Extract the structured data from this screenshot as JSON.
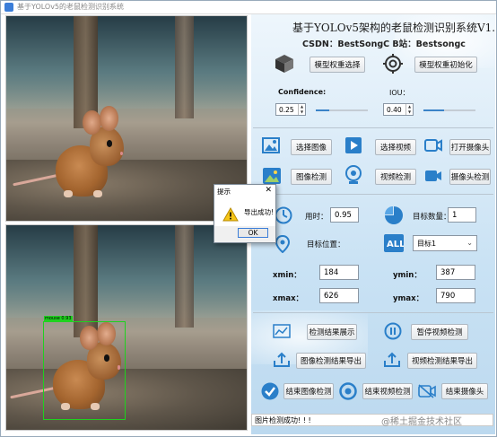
{
  "window": {
    "title": "基于YOLOv5的老鼠检测识别系统"
  },
  "header": {
    "title": "基于YOLOv5架构的老鼠检测识别系统V1.0",
    "subtitle": "CSDN：BestSongC  B站：Bestsongc"
  },
  "model": {
    "select_label": "模型权重选择",
    "init_label": "模型权重初始化"
  },
  "params": {
    "confidence_label": "Confidence:",
    "iou_label": "IOU：",
    "confidence_value": "0.25",
    "iou_value": "0.40",
    "confidence_fraction": 0.25,
    "iou_fraction": 0.4
  },
  "buttons": {
    "select_image": "选择图像",
    "select_video": "选择视频",
    "open_camera": "打开摄像头",
    "image_detect": "图像检测",
    "video_detect": "视频检测",
    "camera_detect": "摄像头检测",
    "show_results": "检测结果展示",
    "pause_video": "暂停视频检测",
    "export_image": "图像检测结果导出",
    "export_video": "视频检测结果导出",
    "end_image": "结束图像检测",
    "end_video": "结束视频检测",
    "end_camera": "结束摄像头"
  },
  "stats": {
    "time_label": "用时：",
    "time_value": "0.95",
    "count_label": "目标数量：",
    "count_value": "1",
    "position_label": "目标位置：",
    "target_select": "目标1"
  },
  "coords": {
    "xmin_label": "xmin：",
    "xmin": "184",
    "ymin_label": "ymin：",
    "ymin": "387",
    "xmax_label": "xmax：",
    "xmax": "626",
    "ymax_label": "ymax：",
    "ymax": "790"
  },
  "detection": {
    "box_label": "mouse 0.93"
  },
  "dialog": {
    "title": "提示",
    "close": "✕",
    "message": "导出成功!",
    "ok": "OK"
  },
  "status": {
    "text": "图片检测成功! ! !"
  },
  "watermark": "@稀土掘金技术社区",
  "colors": {
    "accent": "#3b83c8",
    "box": "#1fd11f"
  }
}
